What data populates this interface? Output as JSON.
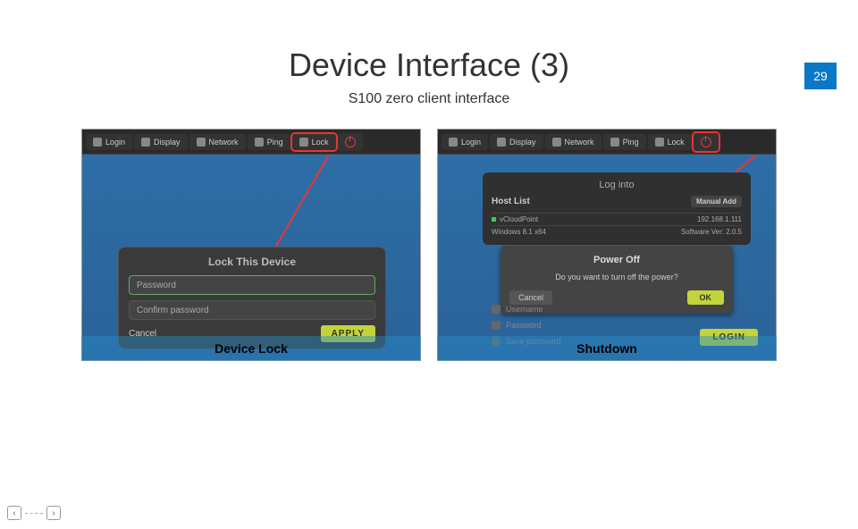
{
  "page_number": "29",
  "title": "Device Interface (3)",
  "subtitle": "S100 zero client interface",
  "left_panel": {
    "toolbar": [
      "Login",
      "Display",
      "Network",
      "Ping",
      "Lock"
    ],
    "dialog_title": "Lock This Device",
    "password_ph": "Password",
    "confirm_ph": "Confirm password",
    "cancel": "Cancel",
    "apply": "APPLY",
    "caption": "Device Lock"
  },
  "right_panel": {
    "toolbar": [
      "Login",
      "Display",
      "Network",
      "Ping",
      "Lock"
    ],
    "login_title": "Log into",
    "hostlist_label": "Host List",
    "manual_add": "Manual Add",
    "host_name": "vCloudPoint",
    "host_os": "Windows 8.1 x64",
    "host_ip": "192.168.1.111",
    "host_ver": "Software Ver: 2.0.5",
    "poweroff_title": "Power Off",
    "poweroff_text": "Do you want to turn off the power?",
    "cancel": "Cancel",
    "ok": "OK",
    "username_ph": "Username",
    "password_ph": "Password",
    "savepw": "Save password",
    "login_btn": "LOGIN",
    "caption": "Shutdown"
  },
  "nav": {
    "prev": "‹",
    "next": "›"
  }
}
